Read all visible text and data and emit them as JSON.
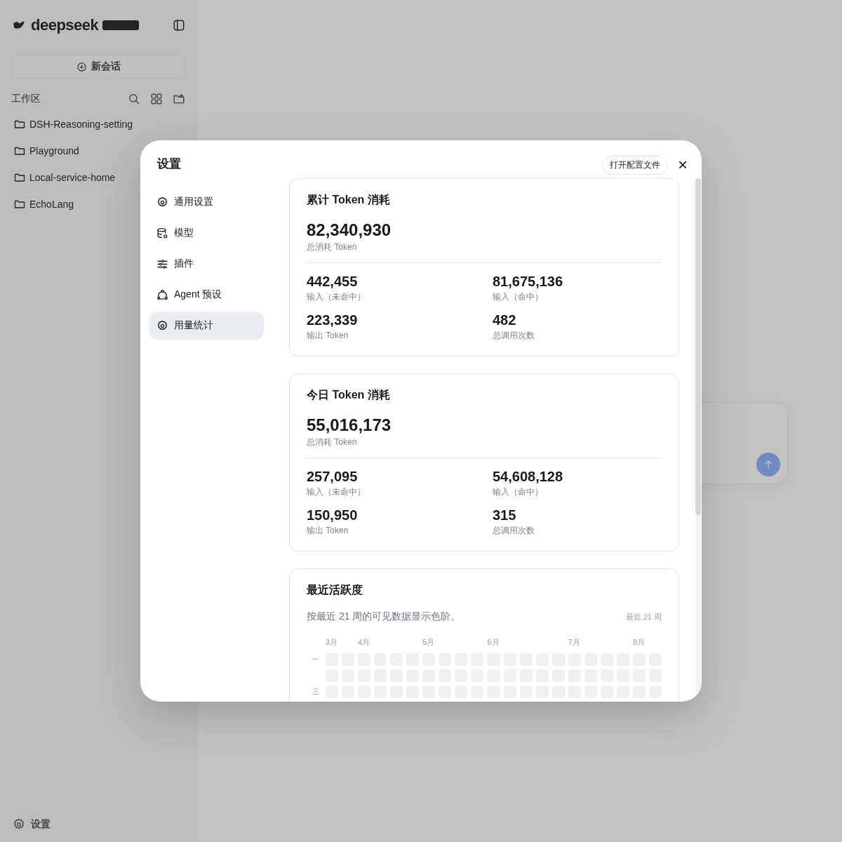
{
  "app_sidebar": {
    "brand": "deepseek",
    "new_chat": "新会话",
    "section_title": "工作区",
    "folders": [
      "DSH-Reasoning-setting",
      "Playground",
      "Local-service-home",
      "EchoLang"
    ],
    "settings_link": "设置"
  },
  "dialog": {
    "title": "设置",
    "open_config_button": "打开配置文件",
    "close_button": "×",
    "nav": [
      {
        "label": "通用设置",
        "selected": false
      },
      {
        "label": "模型",
        "selected": false
      },
      {
        "label": "插件",
        "selected": false
      },
      {
        "label": "Agent 预设",
        "selected": false
      },
      {
        "label": "用量统计",
        "selected": true
      }
    ],
    "stat_cards": [
      {
        "title": "累计 Token 消耗",
        "total": "82,340,930",
        "total_label": "总消耗 Token",
        "stats": [
          {
            "value": "442,455",
            "label": "输入（未命中）"
          },
          {
            "value": "81,675,136",
            "label": "输入（命中）"
          },
          {
            "value": "223,339",
            "label": "输出 Token"
          },
          {
            "value": "482",
            "label": "总调用次数"
          }
        ]
      },
      {
        "title": "今日 Token 消耗",
        "total": "55,016,173",
        "total_label": "总消耗 Token",
        "stats": [
          {
            "value": "257,095",
            "label": "输入（未命中）"
          },
          {
            "value": "54,608,128",
            "label": "输入（命中）"
          },
          {
            "value": "150,950",
            "label": "输出 Token"
          },
          {
            "value": "315",
            "label": "总调用次数"
          }
        ]
      }
    ],
    "activity": {
      "title": "最近活跃度",
      "description": "按最近 21 周的可见数据显示色阶。",
      "range": "最近 21 周",
      "day_labels": [
        "一",
        "三"
      ],
      "weeks": [
        {
          "month": "3月",
          "days": [
            {
              "active": false
            },
            {
              "active": false
            },
            {
              "active": false
            }
          ]
        },
        {
          "days": [
            {
              "active": false
            },
            {
              "active": false
            },
            {
              "active": false
            }
          ]
        },
        {
          "month": "4月",
          "days": [
            {
              "active": false
            },
            {
              "active": false
            },
            {
              "active": false
            }
          ]
        },
        {
          "days": [
            {
              "active": false
            },
            {
              "active": false
            },
            {
              "active": false
            }
          ]
        },
        {
          "days": [
            {
              "active": false
            },
            {
              "active": false
            },
            {
              "active": false
            }
          ]
        },
        {
          "days": [
            {
              "active": false
            },
            {
              "active": false
            },
            {
              "active": false
            }
          ]
        },
        {
          "month": "5月",
          "days": [
            {
              "active": false
            },
            {
              "active": false
            },
            {
              "active": false
            }
          ]
        },
        {
          "days": [
            {
              "active": false
            },
            {
              "active": false
            },
            {
              "active": false
            }
          ]
        },
        {
          "days": [
            {
              "active": false
            },
            {
              "active": false
            },
            {
              "active": false
            }
          ]
        },
        {
          "days": [
            {
              "active": false
            },
            {
              "active": false
            },
            {
              "active": false
            }
          ]
        },
        {
          "month": "6月",
          "days": [
            {
              "active": false
            },
            {
              "active": false
            },
            {
              "active": false
            }
          ]
        },
        {
          "days": [
            {
              "active": false
            },
            {
              "active": false
            },
            {
              "active": false
            }
          ]
        },
        {
          "days": [
            {
              "active": false
            },
            {
              "active": false
            },
            {
              "active": false
            }
          ]
        },
        {
          "days": [
            {
              "active": false
            },
            {
              "active": false
            },
            {
              "active": false
            }
          ]
        },
        {
          "days": [
            {
              "active": false
            },
            {
              "active": false
            },
            {
              "active": false
            }
          ]
        },
        {
          "month": "7月",
          "days": [
            {
              "active": false
            },
            {
              "active": false
            },
            {
              "active": false
            }
          ]
        },
        {
          "days": [
            {
              "active": false
            },
            {
              "active": false
            },
            {
              "active": false
            }
          ]
        },
        {
          "days": [
            {
              "active": false
            },
            {
              "active": false
            },
            {
              "active": false
            }
          ]
        },
        {
          "days": [
            {
              "active": false
            },
            {
              "active": false
            },
            {
              "active": false
            }
          ]
        },
        {
          "month": "8月",
          "days": [
            {
              "active": false
            },
            {
              "active": false
            },
            {
              "active": false
            }
          ]
        },
        {
          "days": [
            {
              "active": false
            },
            {
              "active": false
            },
            {
              "active": false
            }
          ]
        }
      ]
    }
  }
}
